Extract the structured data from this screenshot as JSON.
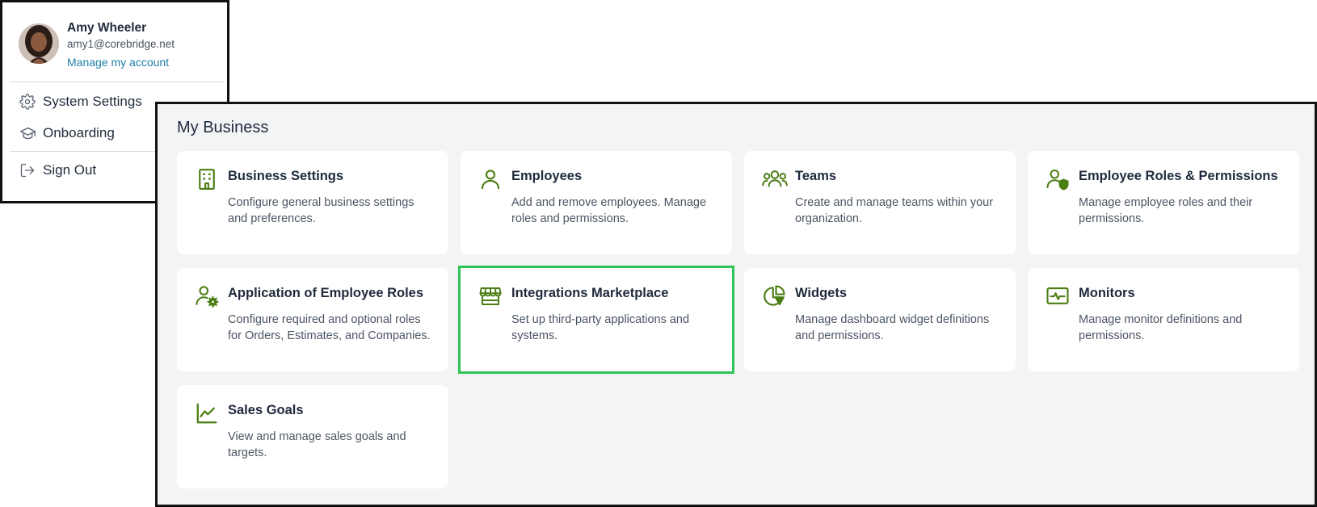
{
  "account": {
    "name": "Amy Wheeler",
    "email": "amy1@corebridge.net",
    "manage_link": "Manage my account",
    "menu": [
      {
        "label": "System Settings",
        "icon": "gear-icon"
      },
      {
        "label": "Onboarding",
        "icon": "graduation-cap-icon"
      },
      {
        "label": "Sign Out",
        "icon": "sign-out-icon"
      }
    ]
  },
  "business": {
    "title": "My Business",
    "cards": [
      {
        "title": "Business Settings",
        "description": "Configure general business settings and preferences.",
        "icon": "building-icon"
      },
      {
        "title": "Employees",
        "description": "Add and remove employees. Manage roles and permissions.",
        "icon": "user-icon"
      },
      {
        "title": "Teams",
        "description": "Create and manage teams within your organization.",
        "icon": "users-icon"
      },
      {
        "title": "Employee Roles & Permissions",
        "description": "Manage employee roles and their permissions.",
        "icon": "user-shield-icon"
      },
      {
        "title": "Application of Employee Roles",
        "description": "Configure required and optional roles for Orders, Estimates, and Companies.",
        "icon": "user-gear-icon"
      },
      {
        "title": "Integrations Marketplace",
        "description": "Set up third-party applications and systems.",
        "icon": "storefront-icon",
        "highlighted": true
      },
      {
        "title": "Widgets",
        "description": "Manage dashboard widget definitions and permissions.",
        "icon": "pie-chart-icon"
      },
      {
        "title": "Monitors",
        "description": "Manage monitor definitions and permissions.",
        "icon": "monitor-pulse-icon"
      },
      {
        "title": "Sales Goals",
        "description": "View and manage sales goals and targets.",
        "icon": "line-chart-icon"
      }
    ]
  },
  "colors": {
    "icon_green": "#4a7d12",
    "highlight_border": "#2ec454",
    "link_blue": "#1f7fa8",
    "panel_bg": "#f3f4f6"
  }
}
